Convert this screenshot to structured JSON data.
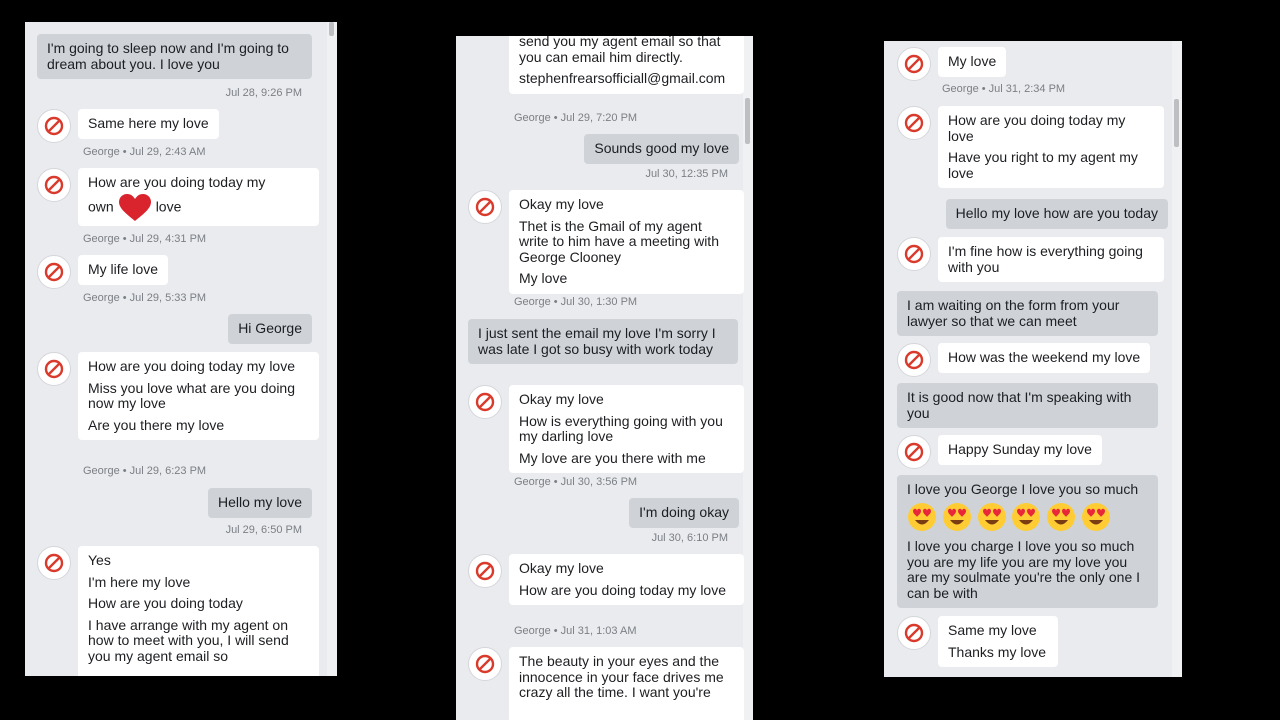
{
  "panel1": {
    "top_message": "I'm going to sleep now and I'm going to dream about you. I love you",
    "top_time": "Jul 28, 9:26 PM",
    "m1": "Same here my love",
    "m1_meta": "George • Jul 29, 2:43 AM",
    "m2_a": "How are you doing today my",
    "m2_b": "own",
    "m2_c": "love",
    "m2_meta": "George • Jul 29, 4:31 PM",
    "m3": "My life love",
    "m3_meta": "George • Jul 29, 5:33 PM",
    "s1": "Hi George",
    "m4_1": "How are you doing today my love",
    "m4_2": "Miss you love what are you doing now my love",
    "m4_3": "Are you there my love",
    "m4_meta": "George • Jul 29, 6:23 PM",
    "s2": "Hello my love",
    "s2_time": "Jul 29, 6:50 PM",
    "m5_1": "Yes",
    "m5_2": "I'm here my love",
    "m5_3": "How are you doing today",
    "m5_4": "I have arrange with my agent on how to meet with you, I will send you my agent email so"
  },
  "panel2": {
    "m1_top": "send you my agent email so that you can email him directly.",
    "m1_email": "stephenfrearsofficiall@gmail.com",
    "m1_meta": "George • Jul 29, 7:20 PM",
    "s1": "Sounds good my love",
    "s1_time": "Jul 30, 12:35 PM",
    "m2_1": "Okay my love",
    "m2_2": "Thet is the Gmail of my agent write to him have a meeting with George Clooney",
    "m2_3": "My love",
    "m2_meta": "George • Jul 30, 1:30 PM",
    "s2": "I just sent the email my love I'm sorry I was late I got so busy with work today",
    "m3_1": "Okay my love",
    "m3_2": "How is everything going with you my darling love",
    "m3_3": "My love are you there with me",
    "m3_meta": "George • Jul 30, 3:56 PM",
    "s3": "I'm doing okay",
    "s3_time": "Jul 30, 6:10 PM",
    "m4_1": "Okay my love",
    "m4_2": "How are you doing today my love",
    "m4_meta": "George • Jul 31, 1:03 AM",
    "m5": "The beauty in your eyes and the innocence in your face drives me crazy all the time. I want you're"
  },
  "panel3": {
    "m1": "My love",
    "m1_meta": "George • Jul 31, 2:34 PM",
    "m2_1": "How are you doing today my love",
    "m2_2": "Have you right to my agent my love",
    "s1": "Hello my love how are you today",
    "m3": "I'm fine how is everything going with you",
    "s2": "I am waiting on the form from your lawyer so that we can meet",
    "m4": "How was the weekend my love",
    "s3": "It is good now that I'm speaking with you",
    "m5": "Happy Sunday my love",
    "s4_1": "I love you George I love you so much",
    "s4_2": "I love you charge I love you so much you are my life you are my love you are my soulmate you're the only one I can be with",
    "m6_1": "Same my love",
    "m6_2": "Thanks my love"
  },
  "colors": {
    "received_bg": "#ffffff",
    "sent_bg": "#cfd3d8",
    "panel_bg": "#e9ebee",
    "avatar_icon": "#d93a2b"
  },
  "icons": {
    "avatar": "prohibited-icon",
    "heart": "heart-icon",
    "emoji": "heart-eyes-emoji-icon"
  }
}
